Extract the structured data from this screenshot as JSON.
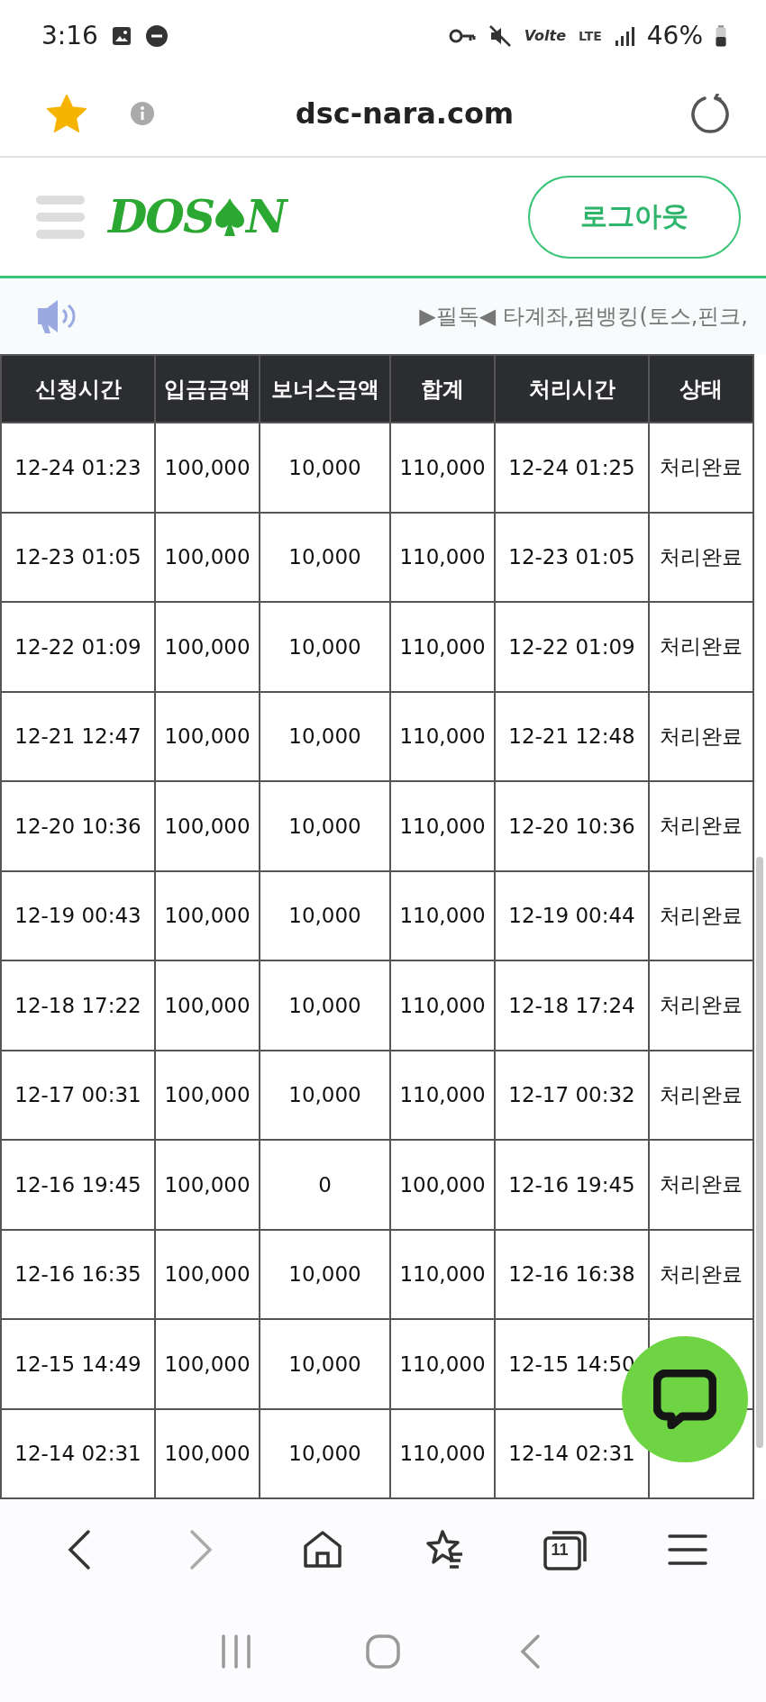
{
  "status_bar": {
    "time": "3:16",
    "volte": "Volte",
    "network": "LTE",
    "battery": "46%"
  },
  "browser_bar": {
    "url": "dsc-nara.com",
    "bookmarked": true
  },
  "site_header": {
    "logo_before": "DOS",
    "logo_after": "N",
    "logout_button": "로그아웃"
  },
  "notice": {
    "text": "▶필독◀ 타계좌,펌뱅킹(토스,핀크,"
  },
  "table": {
    "columns": [
      "신청시간",
      "입금금액",
      "보너스금액",
      "합계",
      "처리시간",
      "상태"
    ],
    "rows": [
      {
        "cells": [
          "12-24 01:23",
          "100,000",
          "10,000",
          "110,000",
          "12-24 01:25",
          "처리완료"
        ]
      },
      {
        "cells": [
          "12-23 01:05",
          "100,000",
          "10,000",
          "110,000",
          "12-23 01:05",
          "처리완료"
        ]
      },
      {
        "cells": [
          "12-22 01:09",
          "100,000",
          "10,000",
          "110,000",
          "12-22 01:09",
          "처리완료"
        ]
      },
      {
        "cells": [
          "12-21 12:47",
          "100,000",
          "10,000",
          "110,000",
          "12-21 12:48",
          "처리완료"
        ]
      },
      {
        "cells": [
          "12-20 10:36",
          "100,000",
          "10,000",
          "110,000",
          "12-20 10:36",
          "처리완료"
        ]
      },
      {
        "cells": [
          "12-19 00:43",
          "100,000",
          "10,000",
          "110,000",
          "12-19 00:44",
          "처리완료"
        ]
      },
      {
        "cells": [
          "12-18 17:22",
          "100,000",
          "10,000",
          "110,000",
          "12-18 17:24",
          "처리완료"
        ]
      },
      {
        "cells": [
          "12-17 00:31",
          "100,000",
          "10,000",
          "110,000",
          "12-17 00:32",
          "처리완료"
        ]
      },
      {
        "cells": [
          "12-16 19:45",
          "100,000",
          "0",
          "100,000",
          "12-16 19:45",
          "처리완료"
        ]
      },
      {
        "cells": [
          "12-16 16:35",
          "100,000",
          "10,000",
          "110,000",
          "12-16 16:38",
          "처리완료"
        ]
      },
      {
        "cells": [
          "12-15 14:49",
          "100,000",
          "10,000",
          "110,000",
          "12-15 14:50"
        ]
      },
      {
        "cells": [
          "12-14 02:31",
          "100,000",
          "10,000",
          "110,000",
          "12-14 02:31"
        ]
      }
    ]
  },
  "browser_nav": {
    "tab_count": "11",
    "forward_disabled": true
  }
}
